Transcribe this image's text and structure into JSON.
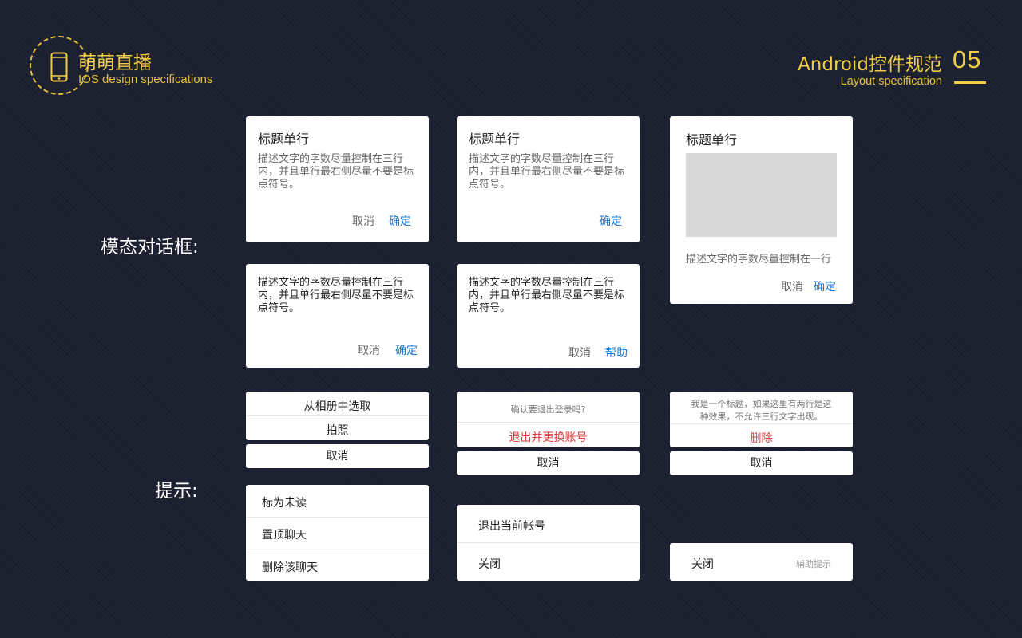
{
  "header": {
    "app_title": "萌萌直播",
    "app_subtitle": "IOS design specifications",
    "spec_title": "Android控件规范",
    "spec_subtitle": "Layout specification",
    "page_number": "05",
    "accent_color": "#f0cd47",
    "logo_icon": "phone-icon"
  },
  "sections": {
    "modal_label": "模态对话框:",
    "hint_label": "提示:"
  },
  "dialogs": {
    "d1": {
      "title": "标题单行",
      "desc": "描述文字的字数尽量控制在三行内，并且单行最右侧尽量不要是标点符号。",
      "cancel": "取消",
      "ok": "确定"
    },
    "d2": {
      "title": "标题单行",
      "desc": "描述文字的字数尽量控制在三行内，并且单行最右侧尽量不要是标点符号。",
      "ok": "确定"
    },
    "d3": {
      "title": "标题单行",
      "desc": "描述文字的字数尽量控制在一行",
      "cancel": "取消",
      "ok": "确定"
    },
    "d4": {
      "desc": "描述文字的字数尽量控制在三行内，并且单行最右侧尽量不要是标点符号。",
      "cancel": "取消",
      "ok": "确定"
    },
    "d5": {
      "desc": "描述文字的字数尽量控制在三行内，并且单行最右侧尽量不要是标点符号。",
      "cancel": "取消",
      "help": "帮助"
    }
  },
  "action_sheets": {
    "s1": {
      "items": [
        "从相册中选取",
        "拍照"
      ],
      "cancel": "取消"
    },
    "s2": {
      "message": "确认要退出登录吗?",
      "action": "退出并更换账号",
      "cancel": "取消"
    },
    "s3": {
      "message_line1": "我是一个标题，如果这里有两行是这",
      "message_line2": "种效果，不允许三行文字出现。",
      "action": "删除",
      "cancel": "取消"
    }
  },
  "menus": {
    "m1": {
      "items": [
        "标为未读",
        "置顶聊天",
        "删除该聊天"
      ]
    },
    "m2": {
      "items": [
        "退出当前帐号",
        "关闭"
      ]
    },
    "m3": {
      "label": "关闭",
      "hint": "辅助提示"
    }
  }
}
